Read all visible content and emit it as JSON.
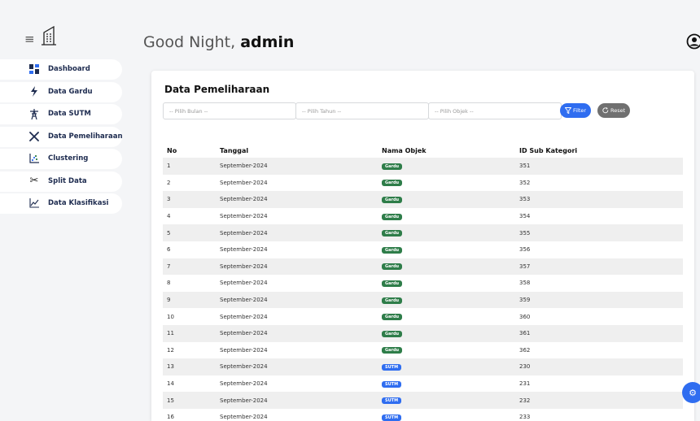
{
  "header": {
    "greeting_prefix": "Good Night,",
    "username": "admin"
  },
  "sidebar": {
    "items": [
      {
        "label": "Dashboard",
        "icon": "dashboard-grid-icon"
      },
      {
        "label": "Data Gardu",
        "icon": "lightning-icon"
      },
      {
        "label": "Data SUTM",
        "icon": "tower-icon"
      },
      {
        "label": "Data Pemeliharaan",
        "icon": "tools-icon"
      },
      {
        "label": "Clustering",
        "icon": "scatter-icon"
      },
      {
        "label": "Split Data",
        "icon": "scissors-icon"
      },
      {
        "label": "Data Klasifikasi",
        "icon": "line-chart-icon"
      }
    ]
  },
  "main": {
    "title": "Data Pemeliharaan",
    "filters": {
      "bulan_placeholder": "-- Pilih Bulan --",
      "tahun_placeholder": "-- Pilih Tahun --",
      "objek_placeholder": "-- Pilih Objek --"
    },
    "buttons": {
      "filter_label": "Filter",
      "reset_label": "Reset"
    },
    "table": {
      "headers": [
        "No",
        "Tanggal",
        "Nama Objek",
        "ID Sub Kategori"
      ],
      "rows": [
        {
          "no": "1",
          "tanggal": "September-2024",
          "objek": "Gardu",
          "id": "351"
        },
        {
          "no": "2",
          "tanggal": "September-2024",
          "objek": "Gardu",
          "id": "352"
        },
        {
          "no": "3",
          "tanggal": "September-2024",
          "objek": "Gardu",
          "id": "353"
        },
        {
          "no": "4",
          "tanggal": "September-2024",
          "objek": "Gardu",
          "id": "354"
        },
        {
          "no": "5",
          "tanggal": "September-2024",
          "objek": "Gardu",
          "id": "355"
        },
        {
          "no": "6",
          "tanggal": "September-2024",
          "objek": "Gardu",
          "id": "356"
        },
        {
          "no": "7",
          "tanggal": "September-2024",
          "objek": "Gardu",
          "id": "357"
        },
        {
          "no": "8",
          "tanggal": "September-2024",
          "objek": "Gardu",
          "id": "358"
        },
        {
          "no": "9",
          "tanggal": "September-2024",
          "objek": "Gardu",
          "id": "359"
        },
        {
          "no": "10",
          "tanggal": "September-2024",
          "objek": "Gardu",
          "id": "360"
        },
        {
          "no": "11",
          "tanggal": "September-2024",
          "objek": "Gardu",
          "id": "361"
        },
        {
          "no": "12",
          "tanggal": "September-2024",
          "objek": "Gardu",
          "id": "362"
        },
        {
          "no": "13",
          "tanggal": "September-2024",
          "objek": "SUTM",
          "id": "230"
        },
        {
          "no": "14",
          "tanggal": "September-2024",
          "objek": "SUTM",
          "id": "231"
        },
        {
          "no": "15",
          "tanggal": "September-2024",
          "objek": "SUTM",
          "id": "232"
        },
        {
          "no": "16",
          "tanggal": "September-2024",
          "objek": "SUTM",
          "id": "233"
        }
      ]
    }
  },
  "colors": {
    "primary": "#2f6df0",
    "gardu_badge": "#2e7d49",
    "reset_button": "#707070",
    "stripe": "#efefef"
  }
}
